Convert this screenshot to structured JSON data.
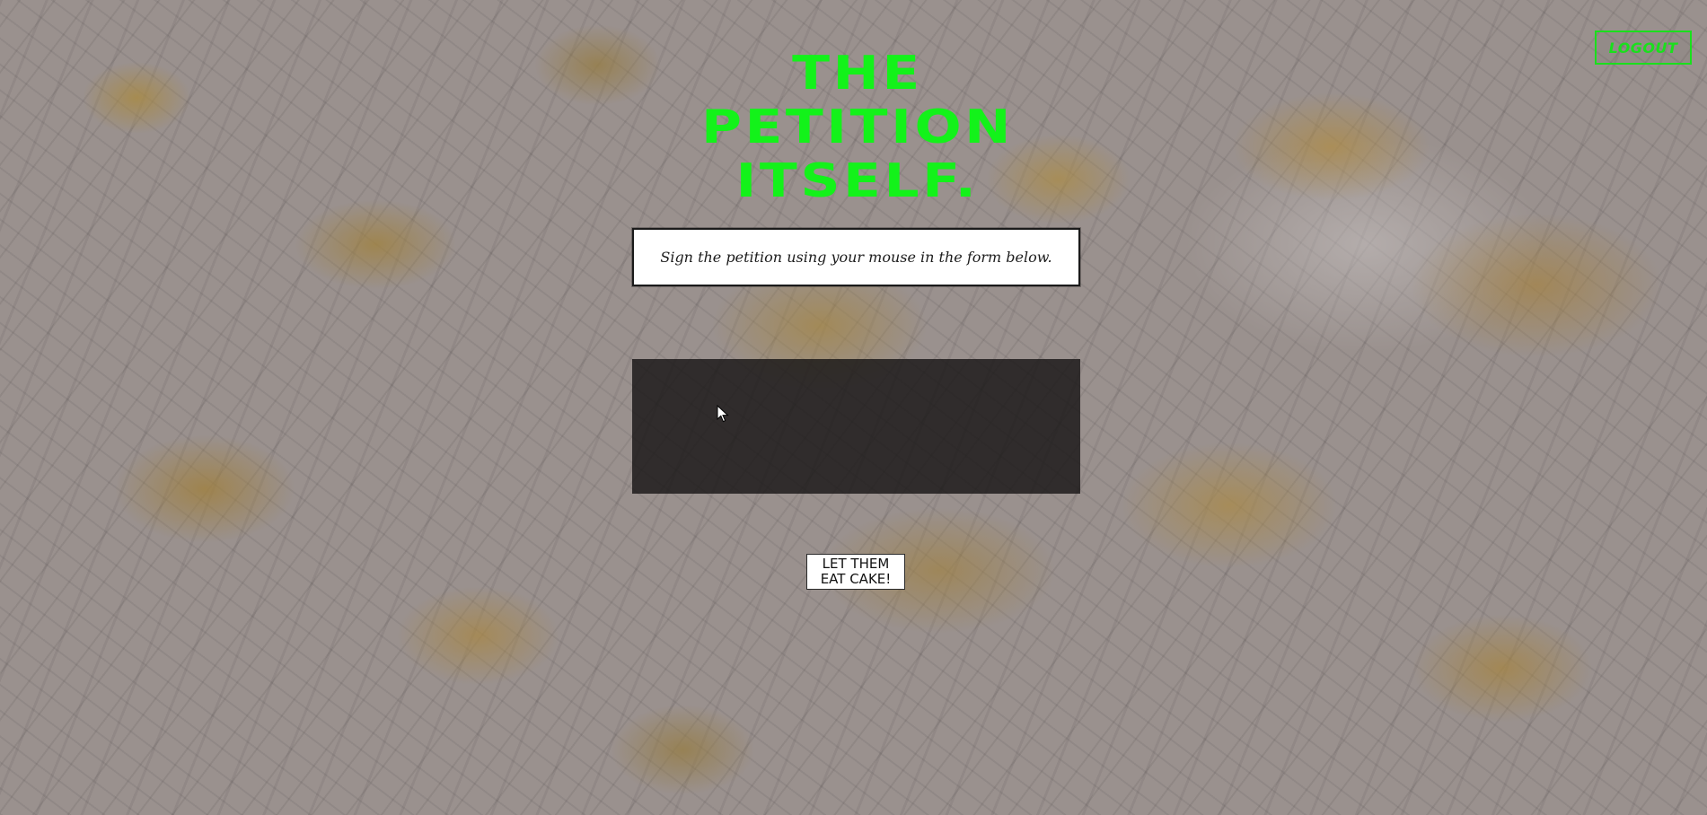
{
  "header": {
    "logout_label": "LOGOUT"
  },
  "hero": {
    "title_lines": [
      "THE",
      "PETITION",
      "ITSELF."
    ]
  },
  "form": {
    "instruction": "Sign the petition using your mouse in the form below.",
    "submit_line1": "LET THEM",
    "submit_line2": "EAT CAKE!"
  },
  "theme": {
    "accent": "#13f21a",
    "canvas_bg": "#1a1818"
  }
}
